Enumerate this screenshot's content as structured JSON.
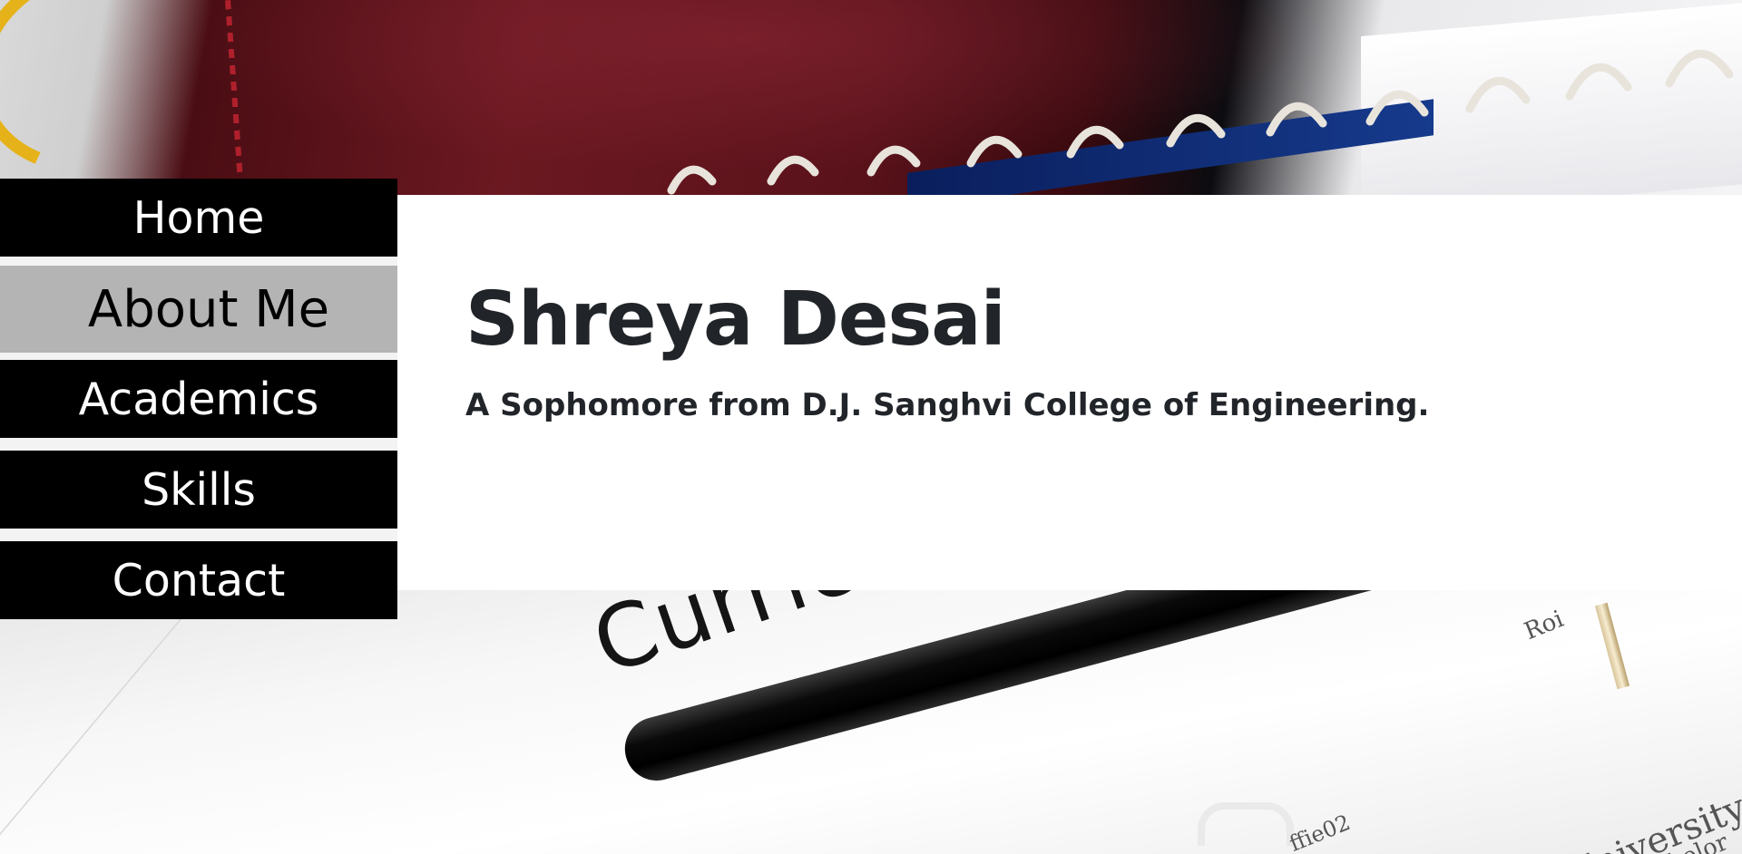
{
  "nav": {
    "items": [
      {
        "label": "Home",
        "active": false
      },
      {
        "label": "About Me",
        "active": true
      },
      {
        "label": "Academics",
        "active": false
      },
      {
        "label": "Skills",
        "active": false
      },
      {
        "label": "Contact",
        "active": false
      }
    ]
  },
  "hero": {
    "name": "Shreya Desai",
    "tagline": "A Sophomore from D.J. Sanghvi College of Engineering."
  },
  "background": {
    "paper_word": "Curric",
    "fine_print": [
      "Roi",
      "University",
      "Bachelor",
      "ffie02"
    ]
  },
  "colors": {
    "nav_bg": "#000000",
    "nav_active_bg": "#b4b4b4",
    "card_bg": "#ffffff",
    "text": "#212529"
  }
}
